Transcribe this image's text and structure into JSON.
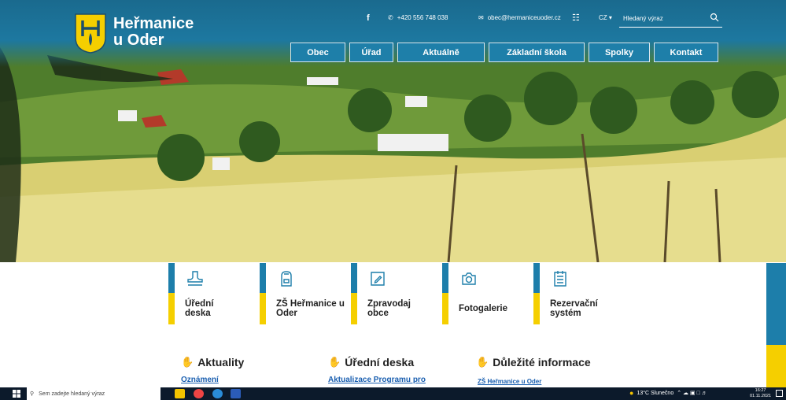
{
  "brand": {
    "line1": "Heřmanice",
    "line2": "u Oder"
  },
  "header": {
    "facebook": "f",
    "phone": "+420 556 748 038",
    "email": "obec@hermaniceuoder.cz",
    "lang": "CZ ▾",
    "search_placeholder": "Hledaný výraz"
  },
  "nav": [
    "Obec",
    "Úřad",
    "Aktuálně",
    "Základní škola",
    "Spolky",
    "Kontakt"
  ],
  "tiles": [
    {
      "label": "Úřední deska",
      "icon": "stamp-icon"
    },
    {
      "label": "ZŠ Heřmanice u Oder",
      "icon": "school-bag-icon"
    },
    {
      "label": "Zpravodaj obce",
      "icon": "pen-note-icon"
    },
    {
      "label": "Fotogalerie",
      "icon": "camera-icon"
    },
    {
      "label": "Rezervační systém",
      "icon": "checklist-icon"
    }
  ],
  "sections": {
    "news": {
      "title": "Aktuality",
      "link": "Oznámení"
    },
    "board": {
      "title": "Úřední deska",
      "link": "Aktualizace Programu pro"
    },
    "info": {
      "title": "Důležité informace",
      "link": "ZŠ Heřmanice u Oder"
    }
  },
  "taskbar": {
    "search_placeholder": "Sem zadejte hledaný výraz",
    "weather": "13°C  Slunečno",
    "time": "16:27",
    "date": "01.11.2021"
  },
  "colors": {
    "primary": "#1d7eaa",
    "accent": "#f5cf00"
  }
}
